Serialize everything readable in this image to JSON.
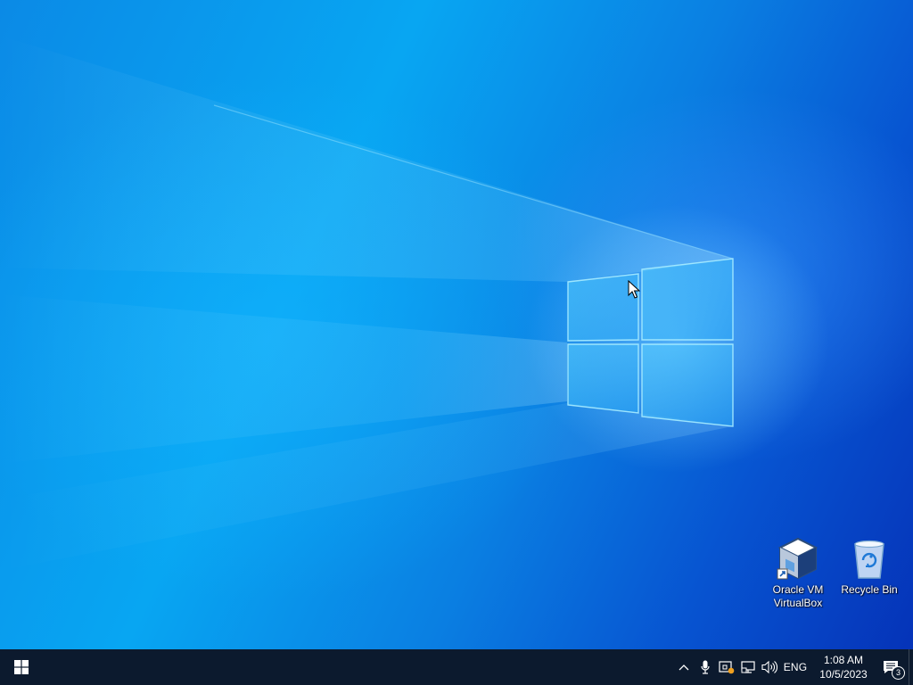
{
  "desktop": {
    "wallpaper": "Windows 10 default hero wallpaper",
    "icons": [
      {
        "name": "virtualbox-icon",
        "label_line1": "Oracle VM",
        "label_line2": "VirtualBox",
        "shortcut": true
      },
      {
        "name": "recycle-bin-icon",
        "label_line1": "Recycle Bin",
        "label_line2": ""
      }
    ]
  },
  "taskbar": {
    "start_icon": "windows-logo-icon",
    "tray": {
      "icons": [
        "chevron-up-icon",
        "microphone-icon",
        "security-icon",
        "network-icon",
        "volume-icon"
      ],
      "language": "ENG",
      "time": "1:08 AM",
      "date": "10/5/2023",
      "notification_count": "3"
    }
  },
  "colors": {
    "taskbar": "#0c1a2e",
    "wallpaper_main": "#0a8ae6",
    "wallpaper_dark": "#0533b8"
  }
}
